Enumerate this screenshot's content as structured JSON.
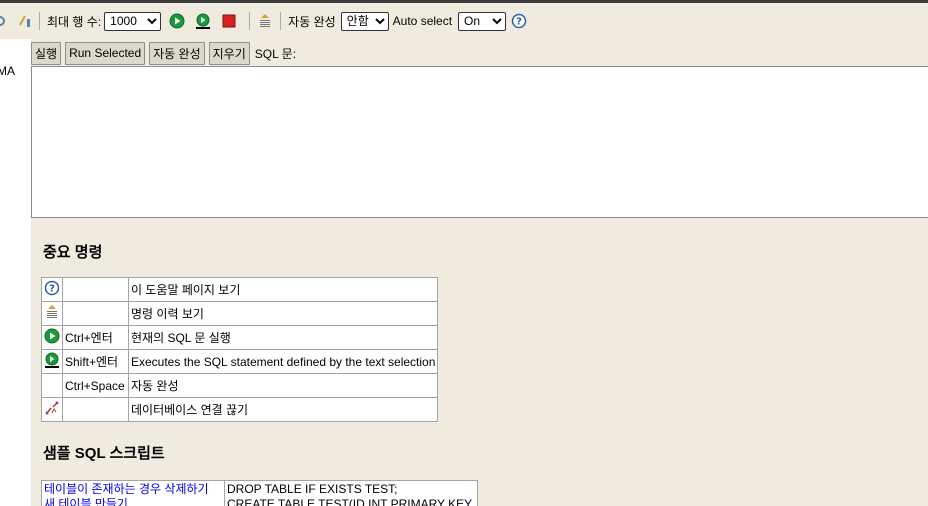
{
  "toolbar": {
    "max_rows_label": "최대 행 수:",
    "max_rows_value": "1000",
    "autocomplete_label": "자동 완성",
    "autocomplete_value": "안함",
    "auto_select_label": "Auto select",
    "auto_select_value": "On"
  },
  "sidebar": {
    "partial_text": "MA"
  },
  "buttons": {
    "run": "실행",
    "run_selected": "Run Selected",
    "autocomplete": "자동 완성",
    "clear": "지우기"
  },
  "sql_label": "SQL 문:",
  "important_commands": {
    "heading": "중요 명령",
    "rows": [
      {
        "icon": "help-icon",
        "key": "",
        "desc": "이 도움말 페이지 보기"
      },
      {
        "icon": "history-icon",
        "key": "",
        "desc": "명령 이력 보기"
      },
      {
        "icon": "run-icon",
        "key": "Ctrl+엔터",
        "desc": "현재의 SQL 문 실행"
      },
      {
        "icon": "run-selected-icon",
        "key": "Shift+엔터",
        "desc": "Executes the SQL statement defined by the text selection"
      },
      {
        "icon": "",
        "key": "Ctrl+Space",
        "desc": "자동 완성"
      },
      {
        "icon": "disconnect-icon",
        "key": "",
        "desc": "데이터베이스 연결 끊기"
      }
    ]
  },
  "samples": {
    "heading": "샘플 SQL 스크립트",
    "rows": [
      {
        "link": "테이블이 존재하는 경우 삭제하기",
        "sql": "DROP TABLE IF EXISTS TEST;"
      },
      {
        "link": "새 테이블 만들기",
        "sql": "CREATE TABLE TEST(ID INT PRIMARY KEY,"
      }
    ]
  },
  "colors": {
    "background": "#efecdf",
    "run_green": "#1a9a3a",
    "stop_red": "#d42020",
    "link_blue": "#0000ee"
  }
}
